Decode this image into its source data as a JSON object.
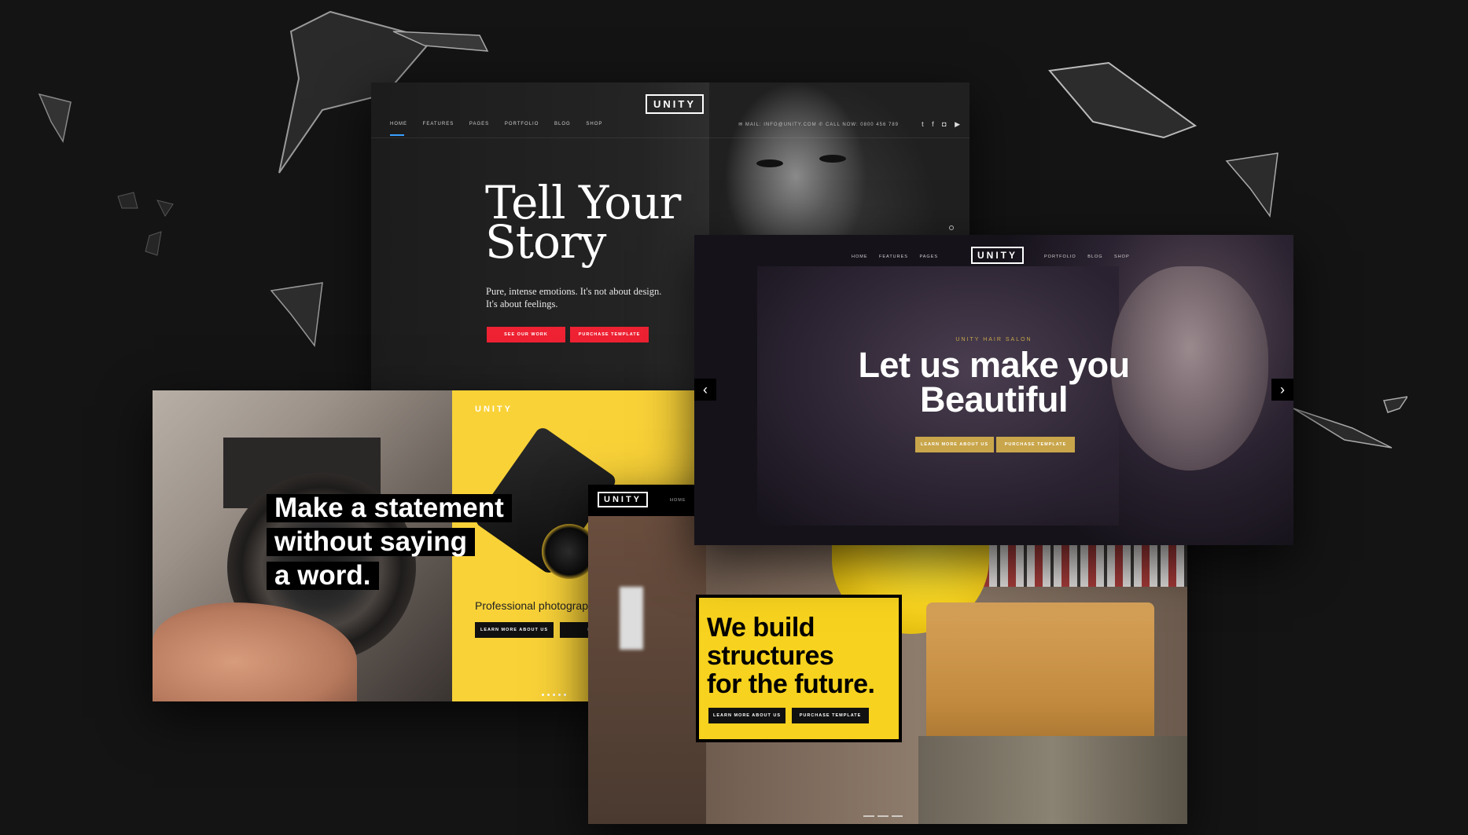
{
  "card1": {
    "logo": "UNITY",
    "nav": [
      "HOME",
      "FEATURES",
      "PAGES",
      "PORTFOLIO",
      "BLOG",
      "SHOP"
    ],
    "contact": "✉ MAIL: INFO@UNITY.COM   ✆ CALL NOW: 0800 456 789",
    "headline": "Tell Your Story",
    "subtitle": "Pure, intense emotions. It's not about design. It's about feelings.",
    "button_primary": "SEE OUR WORK",
    "button_secondary": "PURCHASE TEMPLATE",
    "accent": "#ee2233"
  },
  "card2": {
    "logo": "UNITY",
    "headline_lines": [
      "Make a statement",
      "without saying",
      "a word."
    ],
    "tagline": "Professional photograph",
    "button_primary": "LEARN MORE ABOUT US",
    "button_secondary": "PURCHA",
    "accent": "#f9d238"
  },
  "card3": {
    "logo": "UNITY",
    "nav_home": "HOME",
    "headline_lines": [
      "We build",
      "structures",
      "for the future."
    ],
    "button_primary": "LEARN MORE ABOUT US",
    "button_secondary": "PURCHASE TEMPLATE",
    "accent": "#f7d21e"
  },
  "card4": {
    "logo": "UNITY",
    "nav_left": [
      "HOME",
      "FEATURES",
      "PAGES"
    ],
    "nav_right": [
      "PORTFOLIO",
      "BLOG",
      "SHOP"
    ],
    "eyebrow": "UNITY HAIR SALON",
    "headline_lines": [
      "Let us make you",
      "Beautiful"
    ],
    "button_primary": "LEARN MORE ABOUT US",
    "button_secondary": "PURCHASE TEMPLATE",
    "prev_icon": "‹",
    "next_icon": "›",
    "accent": "#c9a64b"
  }
}
